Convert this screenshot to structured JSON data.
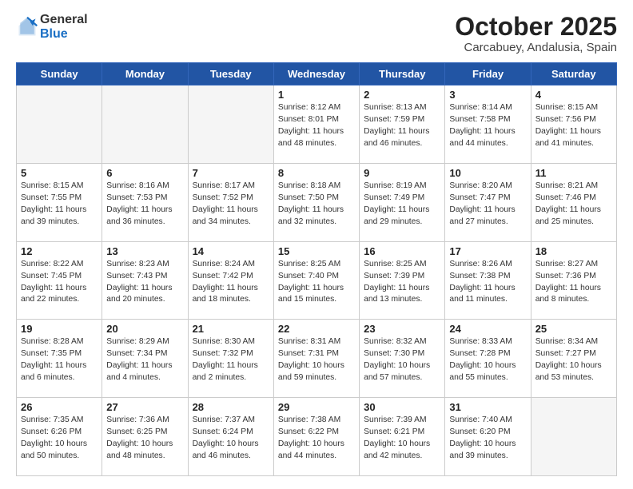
{
  "logo": {
    "general": "General",
    "blue": "Blue"
  },
  "header": {
    "month": "October 2025",
    "location": "Carcabuey, Andalusia, Spain"
  },
  "weekdays": [
    "Sunday",
    "Monday",
    "Tuesday",
    "Wednesday",
    "Thursday",
    "Friday",
    "Saturday"
  ],
  "weeks": [
    [
      {
        "day": "",
        "info": ""
      },
      {
        "day": "",
        "info": ""
      },
      {
        "day": "",
        "info": ""
      },
      {
        "day": "1",
        "info": "Sunrise: 8:12 AM\nSunset: 8:01 PM\nDaylight: 11 hours and 48 minutes."
      },
      {
        "day": "2",
        "info": "Sunrise: 8:13 AM\nSunset: 7:59 PM\nDaylight: 11 hours and 46 minutes."
      },
      {
        "day": "3",
        "info": "Sunrise: 8:14 AM\nSunset: 7:58 PM\nDaylight: 11 hours and 44 minutes."
      },
      {
        "day": "4",
        "info": "Sunrise: 8:15 AM\nSunset: 7:56 PM\nDaylight: 11 hours and 41 minutes."
      }
    ],
    [
      {
        "day": "5",
        "info": "Sunrise: 8:15 AM\nSunset: 7:55 PM\nDaylight: 11 hours and 39 minutes."
      },
      {
        "day": "6",
        "info": "Sunrise: 8:16 AM\nSunset: 7:53 PM\nDaylight: 11 hours and 36 minutes."
      },
      {
        "day": "7",
        "info": "Sunrise: 8:17 AM\nSunset: 7:52 PM\nDaylight: 11 hours and 34 minutes."
      },
      {
        "day": "8",
        "info": "Sunrise: 8:18 AM\nSunset: 7:50 PM\nDaylight: 11 hours and 32 minutes."
      },
      {
        "day": "9",
        "info": "Sunrise: 8:19 AM\nSunset: 7:49 PM\nDaylight: 11 hours and 29 minutes."
      },
      {
        "day": "10",
        "info": "Sunrise: 8:20 AM\nSunset: 7:47 PM\nDaylight: 11 hours and 27 minutes."
      },
      {
        "day": "11",
        "info": "Sunrise: 8:21 AM\nSunset: 7:46 PM\nDaylight: 11 hours and 25 minutes."
      }
    ],
    [
      {
        "day": "12",
        "info": "Sunrise: 8:22 AM\nSunset: 7:45 PM\nDaylight: 11 hours and 22 minutes."
      },
      {
        "day": "13",
        "info": "Sunrise: 8:23 AM\nSunset: 7:43 PM\nDaylight: 11 hours and 20 minutes."
      },
      {
        "day": "14",
        "info": "Sunrise: 8:24 AM\nSunset: 7:42 PM\nDaylight: 11 hours and 18 minutes."
      },
      {
        "day": "15",
        "info": "Sunrise: 8:25 AM\nSunset: 7:40 PM\nDaylight: 11 hours and 15 minutes."
      },
      {
        "day": "16",
        "info": "Sunrise: 8:25 AM\nSunset: 7:39 PM\nDaylight: 11 hours and 13 minutes."
      },
      {
        "day": "17",
        "info": "Sunrise: 8:26 AM\nSunset: 7:38 PM\nDaylight: 11 hours and 11 minutes."
      },
      {
        "day": "18",
        "info": "Sunrise: 8:27 AM\nSunset: 7:36 PM\nDaylight: 11 hours and 8 minutes."
      }
    ],
    [
      {
        "day": "19",
        "info": "Sunrise: 8:28 AM\nSunset: 7:35 PM\nDaylight: 11 hours and 6 minutes."
      },
      {
        "day": "20",
        "info": "Sunrise: 8:29 AM\nSunset: 7:34 PM\nDaylight: 11 hours and 4 minutes."
      },
      {
        "day": "21",
        "info": "Sunrise: 8:30 AM\nSunset: 7:32 PM\nDaylight: 11 hours and 2 minutes."
      },
      {
        "day": "22",
        "info": "Sunrise: 8:31 AM\nSunset: 7:31 PM\nDaylight: 10 hours and 59 minutes."
      },
      {
        "day": "23",
        "info": "Sunrise: 8:32 AM\nSunset: 7:30 PM\nDaylight: 10 hours and 57 minutes."
      },
      {
        "day": "24",
        "info": "Sunrise: 8:33 AM\nSunset: 7:28 PM\nDaylight: 10 hours and 55 minutes."
      },
      {
        "day": "25",
        "info": "Sunrise: 8:34 AM\nSunset: 7:27 PM\nDaylight: 10 hours and 53 minutes."
      }
    ],
    [
      {
        "day": "26",
        "info": "Sunrise: 7:35 AM\nSunset: 6:26 PM\nDaylight: 10 hours and 50 minutes."
      },
      {
        "day": "27",
        "info": "Sunrise: 7:36 AM\nSunset: 6:25 PM\nDaylight: 10 hours and 48 minutes."
      },
      {
        "day": "28",
        "info": "Sunrise: 7:37 AM\nSunset: 6:24 PM\nDaylight: 10 hours and 46 minutes."
      },
      {
        "day": "29",
        "info": "Sunrise: 7:38 AM\nSunset: 6:22 PM\nDaylight: 10 hours and 44 minutes."
      },
      {
        "day": "30",
        "info": "Sunrise: 7:39 AM\nSunset: 6:21 PM\nDaylight: 10 hours and 42 minutes."
      },
      {
        "day": "31",
        "info": "Sunrise: 7:40 AM\nSunset: 6:20 PM\nDaylight: 10 hours and 39 minutes."
      },
      {
        "day": "",
        "info": ""
      }
    ]
  ]
}
